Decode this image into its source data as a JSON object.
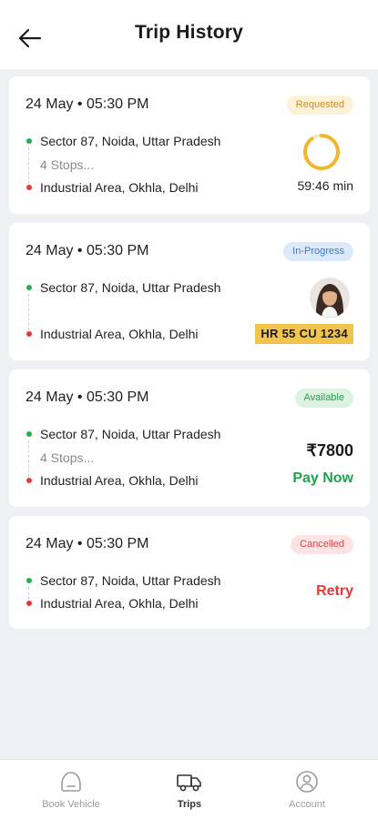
{
  "header": {
    "title": "Trip History"
  },
  "trips": [
    {
      "datetime": "24 May • 05:30 PM",
      "status": "Requested",
      "pickup": "Sector 87, Noida, Uttar Pradesh",
      "stops": "4 Stops...",
      "drop": "Industrial Area, Okhla, Delhi",
      "timer": "59:46 min",
      "timer_progress": 0.9
    },
    {
      "datetime": "24 May • 05:30 PM",
      "status": "In-Progress",
      "pickup": "Sector 87, Noida, Uttar Pradesh",
      "drop": "Industrial Area, Okhla, Delhi",
      "vehicle_number": "HR 55 CU 1234"
    },
    {
      "datetime": "24 May • 05:30 PM",
      "status": "Available",
      "pickup": "Sector 87, Noida, Uttar Pradesh",
      "stops": "4 Stops...",
      "drop": "Industrial Area, Okhla, Delhi",
      "price": "₹7800",
      "action": "Pay Now"
    },
    {
      "datetime": "24 May • 05:30 PM",
      "status": "Cancelled",
      "pickup": "Sector 87, Noida, Uttar Pradesh",
      "drop": "Industrial Area, Okhla, Delhi",
      "action": "Retry"
    }
  ],
  "tabs": [
    {
      "label": "Book Vehicle",
      "icon": "book-vehicle-icon"
    },
    {
      "label": "Trips",
      "icon": "truck-icon",
      "active": true
    },
    {
      "label": "Account",
      "icon": "account-icon"
    }
  ],
  "colors": {
    "green": "#22b14c",
    "red": "#e53935",
    "ring": "#f0b72a",
    "plate": "#f3c44c"
  }
}
